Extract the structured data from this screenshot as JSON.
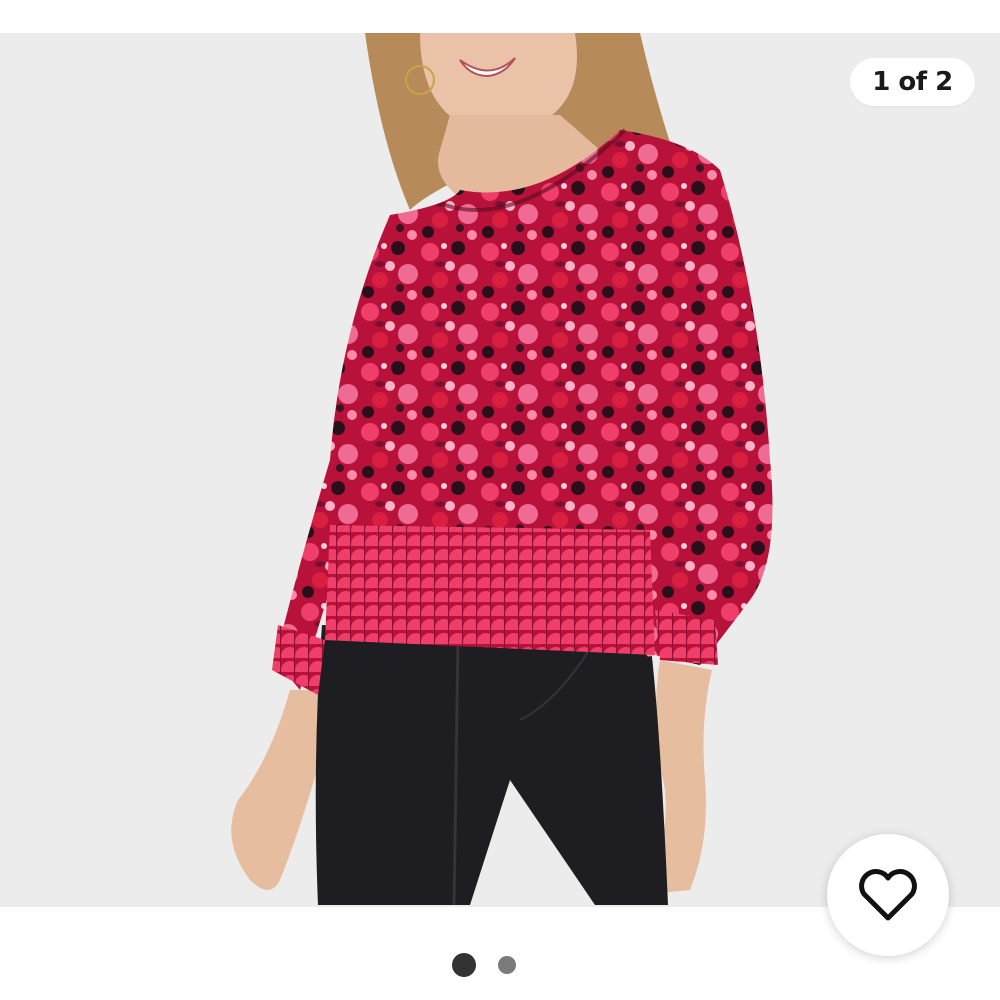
{
  "carousel": {
    "counter_text": "1 of 2",
    "current_index": 1,
    "total": 2
  },
  "colors": {
    "photo_background": "#ececec",
    "page_background": "#ffffff",
    "text": "#1a1a1a",
    "dot_active": "#333333",
    "dot_inactive": "#7a7a7a"
  },
  "icons": {
    "like": "heart-outline-icon"
  }
}
